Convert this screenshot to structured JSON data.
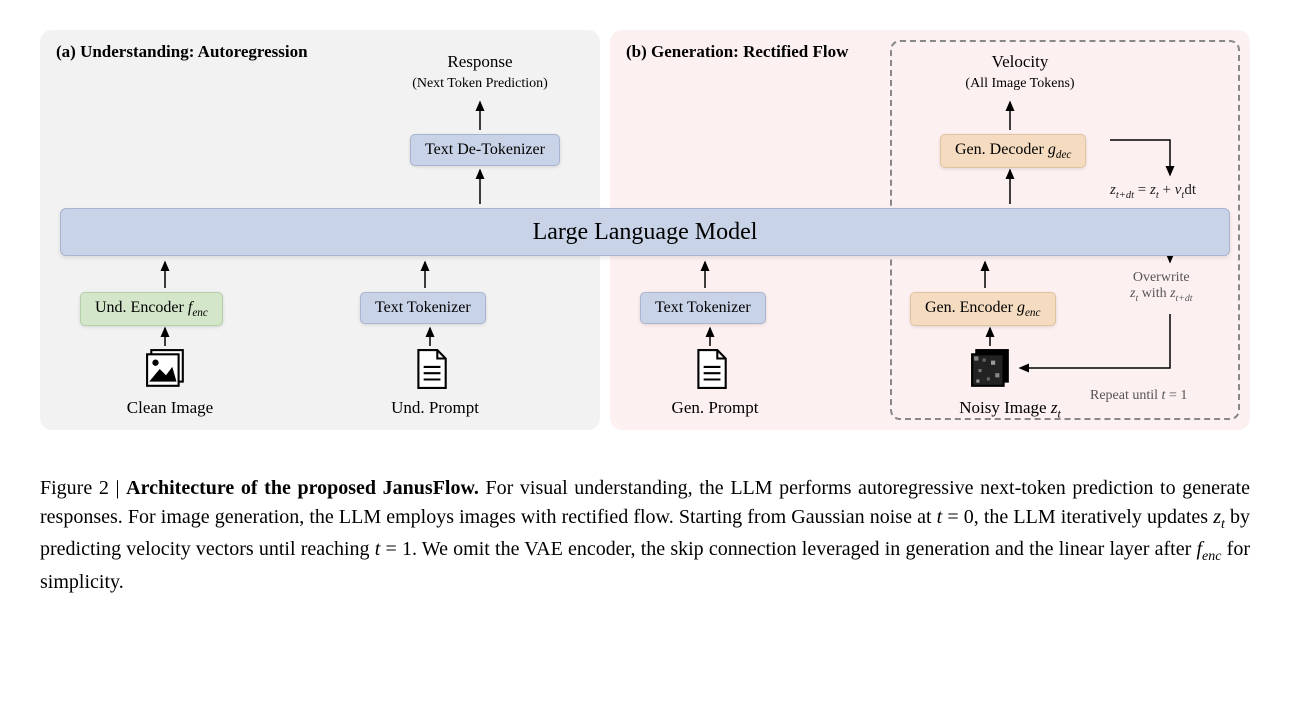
{
  "panel_a_title": "(a) Understanding: Autoregression",
  "panel_b_title": "(b) Generation: Rectified Flow",
  "llm_label": "Large Language Model",
  "response_label": "Response",
  "response_sub": "(Next Token Prediction)",
  "velocity_label": "Velocity",
  "velocity_sub": "(All Image Tokens)",
  "text_detokenizer": "Text De-Tokenizer",
  "gen_decoder": "Gen. Decoder ",
  "gen_decoder_math": "g",
  "gen_decoder_sub": "dec",
  "und_encoder": "Und. Encoder ",
  "und_encoder_math": "f",
  "und_encoder_sub": "enc",
  "text_tokenizer": "Text Tokenizer",
  "gen_encoder": "Gen. Encoder ",
  "gen_encoder_math": "g",
  "gen_encoder_sub": "enc",
  "clean_image": "Clean Image",
  "und_prompt": "Und. Prompt",
  "gen_prompt": "Gen. Prompt",
  "noisy_image": "Noisy Image ",
  "noisy_image_math": "z",
  "noisy_image_sub": "t",
  "eq_line": "z",
  "eq_sub1": "t+dt",
  "eq_eq": " = ",
  "eq_z2": "z",
  "eq_sub2": "t",
  "eq_plus": " + ",
  "eq_v": "v",
  "eq_sub3": "t",
  "eq_dt": "dt",
  "overwrite_label": "Overwrite",
  "overwrite_line2a": "z",
  "overwrite_sub2a": "t",
  "overwrite_with": " with ",
  "overwrite_line2b": "z",
  "overwrite_sub2b": "t+dt",
  "repeat_label": "Repeat until ",
  "repeat_math": "t",
  "repeat_eq": " = 1",
  "caption_fig": "Figure 2 | ",
  "caption_bold": "Architecture of the proposed JanusFlow.",
  "caption_body1": " For visual understanding, the LLM performs autoregressive next-token prediction to generate responses. For image generation, the LLM employs images with rectified flow. Starting from Gaussian noise at ",
  "caption_t0": "t",
  "caption_eq0": " = 0, the LLM iteratively updates ",
  "caption_zt": "z",
  "caption_zt_sub": "t",
  "caption_body2": " by predicting velocity vectors until reaching ",
  "caption_t1": "t",
  "caption_eq1": " = 1. We omit the VAE encoder, the skip connection leveraged in generation and the linear layer after ",
  "caption_fenc": "f",
  "caption_fenc_sub": "enc",
  "caption_body3": " for simplicity."
}
